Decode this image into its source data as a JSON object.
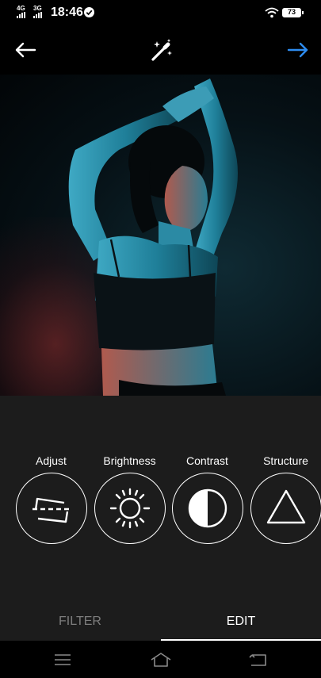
{
  "status_bar": {
    "network_1": "4G",
    "network_2": "3G",
    "time": "18:46",
    "battery": "73"
  },
  "top_bar": {
    "back_icon": "arrow-left-icon",
    "auto_enhance_icon": "magic-wand-icon",
    "next_icon": "arrow-right-icon",
    "next_color": "#2d8cf0"
  },
  "photo": {
    "description_icon": "photo-preview"
  },
  "tools": [
    {
      "label": "Adjust",
      "icon": "adjust-icon"
    },
    {
      "label": "Brightness",
      "icon": "brightness-icon"
    },
    {
      "label": "Contrast",
      "icon": "contrast-icon"
    },
    {
      "label": "Structure",
      "icon": "structure-icon"
    }
  ],
  "tabs": {
    "filter": "FILTER",
    "edit": "EDIT",
    "active": "edit"
  },
  "nav_bar": {
    "menu_icon": "menu-icon",
    "home_icon": "home-icon",
    "back_icon": "back-icon"
  }
}
